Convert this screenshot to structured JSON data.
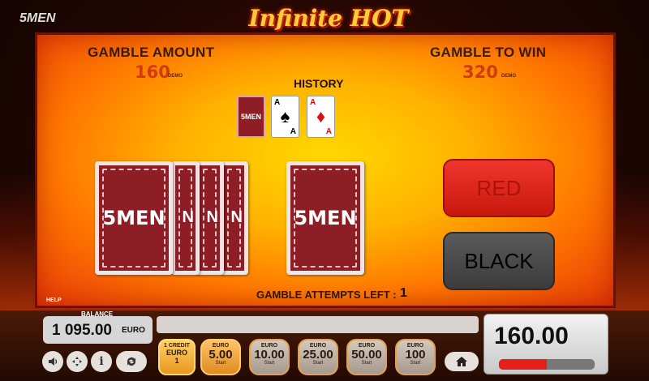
{
  "header": {
    "brand": "5MEN",
    "title": "Infinite HOT"
  },
  "gamble": {
    "amount_label": "GAMBLE AMOUNT",
    "amount_value": "160",
    "amount_unit": "DEMO",
    "to_win_label": "GAMBLE TO WIN",
    "to_win_value": "320",
    "to_win_unit": "DEMO",
    "history_label": "HISTORY",
    "history": [
      {
        "type": "back",
        "label": "5MEN"
      },
      {
        "type": "face",
        "rank": "A",
        "suit": "spades",
        "glyph": "♠",
        "color": "#000000"
      },
      {
        "type": "face",
        "rank": "A",
        "suit": "diamonds",
        "glyph": "♦",
        "color": "#d81010"
      }
    ],
    "deck_logo": "5MEN",
    "deck_edge_logo": "N",
    "card_logo": "5MEN",
    "red_button": "RED",
    "black_button": "BLACK",
    "attempts_label": "GAMBLE ATTEMPTS LEFT :",
    "attempts_value": "1",
    "help_label": "HELP"
  },
  "bottom": {
    "balance_label": "BALANCE",
    "balance_value": "1 095.00",
    "balance_currency": "EURO",
    "icons": [
      "sound-icon",
      "settings-icon",
      "info-icon",
      "autoplay-icon"
    ],
    "credit": {
      "line1": "1 CREDIT",
      "line2": "EURO",
      "line3": "1"
    },
    "bets": [
      {
        "currency": "EURO",
        "value": "5.00",
        "start": "Start",
        "selected": true
      },
      {
        "currency": "EURO",
        "value": "10.00",
        "start": "Start",
        "selected": false
      },
      {
        "currency": "EURO",
        "value": "25.00",
        "start": "Start",
        "selected": false
      },
      {
        "currency": "EURO",
        "value": "50.00",
        "start": "Start",
        "selected": false
      },
      {
        "currency": "EURO",
        "value": "100",
        "start": "Start",
        "selected": false
      }
    ],
    "win_value": "160.00",
    "win_progress": 0.5
  },
  "colors": {
    "accent": "#ffb300",
    "red": "#e52018",
    "brand_red": "#8d1e26"
  }
}
